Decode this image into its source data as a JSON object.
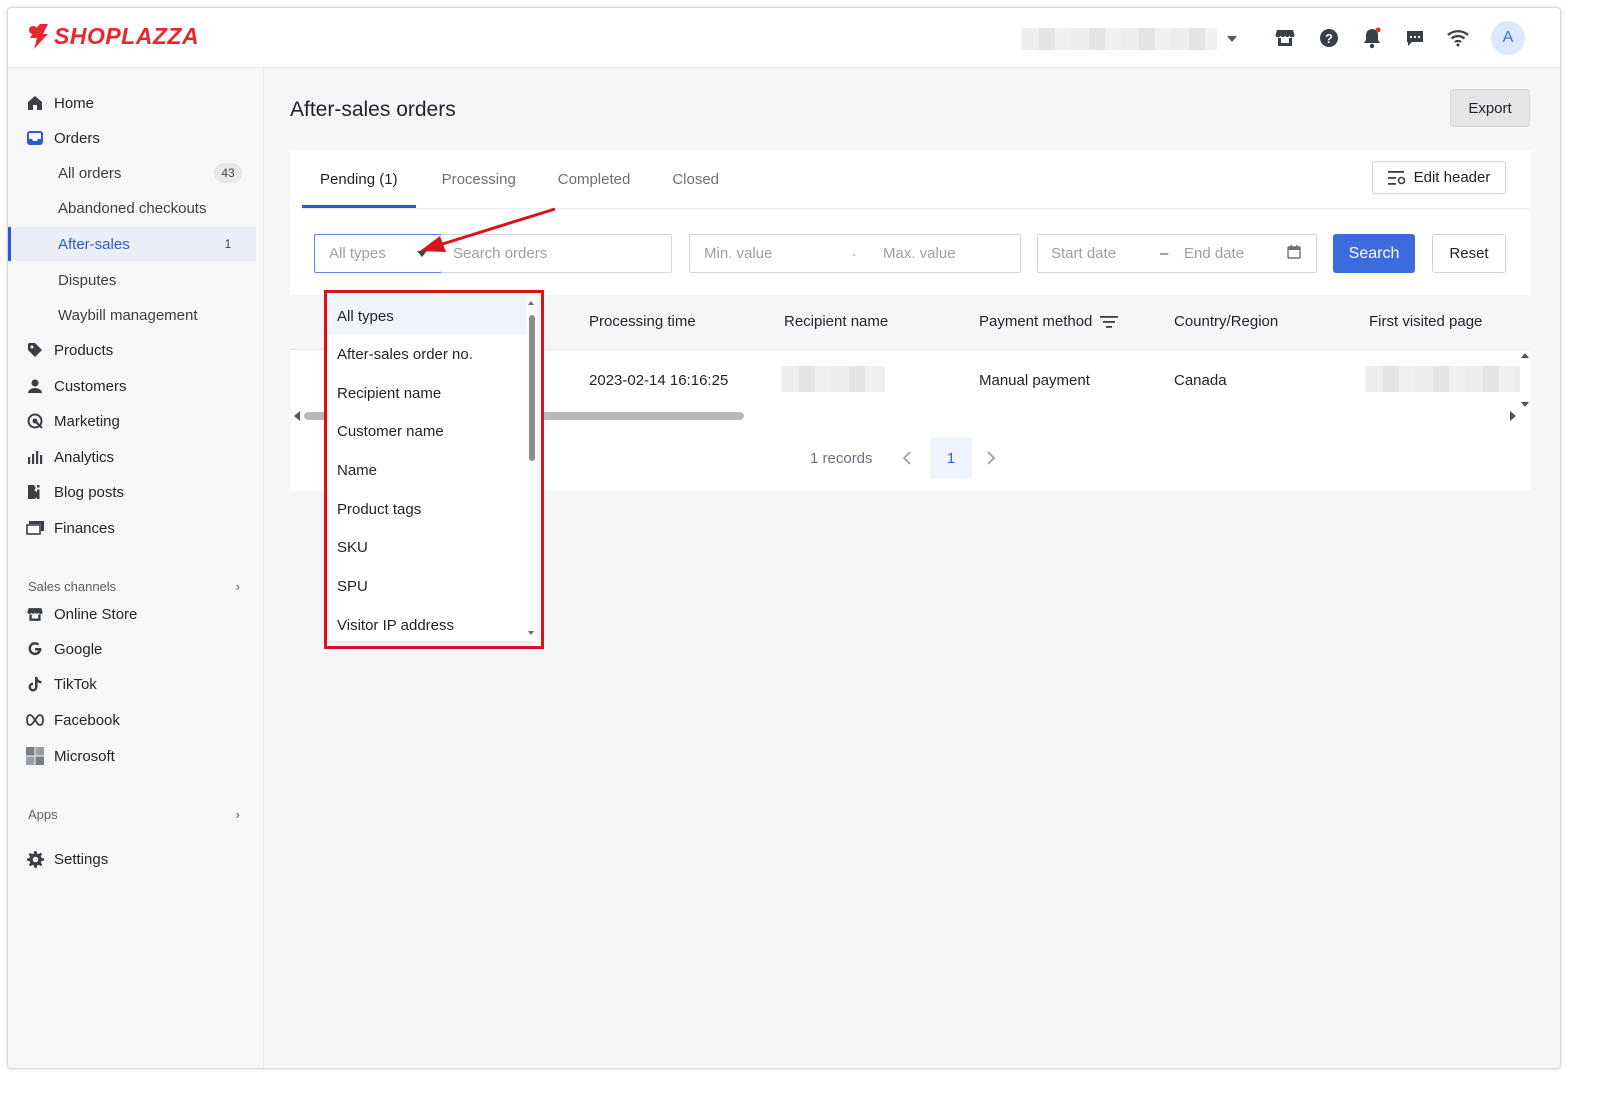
{
  "app": {
    "brand": "SHOPLAZZA",
    "avatar_initial": "A"
  },
  "topbar_icons": [
    "store-icon",
    "help-icon",
    "bell-icon",
    "chat-icon",
    "wifi-icon"
  ],
  "sidebar": {
    "home": "Home",
    "orders": "Orders",
    "all_orders": "All orders",
    "all_orders_count": "43",
    "abandoned": "Abandoned checkouts",
    "after_sales": "After-sales",
    "after_sales_count": "1",
    "disputes": "Disputes",
    "waybill": "Waybill management",
    "products": "Products",
    "customers": "Customers",
    "marketing": "Marketing",
    "analytics": "Analytics",
    "blog": "Blog posts",
    "finances": "Finances",
    "sales_channels": "Sales channels",
    "online_store": "Online Store",
    "google": "Google",
    "tiktok": "TikTok",
    "facebook": "Facebook",
    "microsoft": "Microsoft",
    "apps": "Apps",
    "settings": "Settings"
  },
  "page": {
    "title": "After-sales orders",
    "export": "Export",
    "edit_header": "Edit header"
  },
  "tabs": {
    "pending": "Pending",
    "pending_count": "(1)",
    "processing": "Processing",
    "completed": "Completed",
    "closed": "Closed"
  },
  "filters": {
    "type_selected": "All types",
    "search_placeholder": "Search orders",
    "min_placeholder": "Min. value",
    "range_sep": "-",
    "max_placeholder": "Max. value",
    "start_placeholder": "Start date",
    "date_sep": "–",
    "end_placeholder": "End date",
    "search_btn": "Search",
    "reset_btn": "Reset"
  },
  "table": {
    "headers": {
      "processing_time": "Processing time",
      "recipient": "Recipient name",
      "payment": "Payment method",
      "country": "Country/Region",
      "first_page": "First visited page"
    },
    "row": {
      "processing_time": "2023-02-14 16:16:25",
      "payment": "Manual payment",
      "country": "Canada"
    }
  },
  "pagination": {
    "records": "1 records",
    "current_page": "1"
  },
  "dropdown": {
    "options": [
      "All types",
      "After-sales order no.",
      "Recipient name",
      "Customer name",
      "Name",
      "Product tags",
      "SKU",
      "SPU",
      "Visitor IP address"
    ]
  },
  "colors": {
    "brand": "#e8262e",
    "accent": "#3c6be0",
    "highlight": "#d9141d"
  }
}
